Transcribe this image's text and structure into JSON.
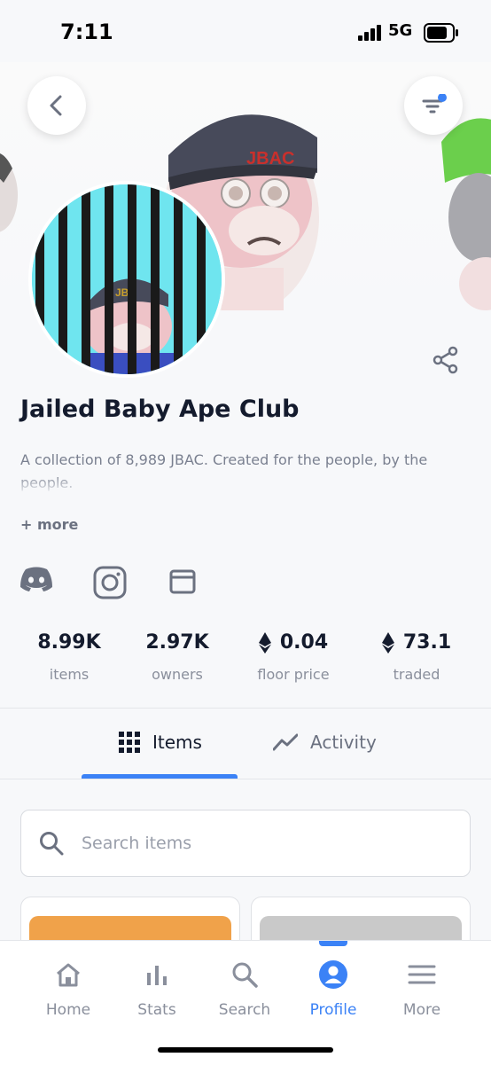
{
  "status_bar": {
    "time": "7:11",
    "network": "5G"
  },
  "collection": {
    "name": "Jailed Baby Ape Club",
    "description": "A collection of 8,989 JBAC. Created for the people, by the people.",
    "more_label": "+ more",
    "avatar_text": "JB",
    "banner_text": "JBAC"
  },
  "social": [
    {
      "name": "discord-icon"
    },
    {
      "name": "instagram-icon"
    },
    {
      "name": "website-icon"
    }
  ],
  "stats": [
    {
      "value": "8.99K",
      "label": "items",
      "eth": false
    },
    {
      "value": "2.97K",
      "label": "owners",
      "eth": false
    },
    {
      "value": "0.04",
      "label": "floor price",
      "eth": true
    },
    {
      "value": "73.1",
      "label": "traded",
      "eth": true
    }
  ],
  "tabs": [
    {
      "label": "Items",
      "active": true
    },
    {
      "label": "Activity",
      "active": false
    }
  ],
  "search": {
    "placeholder": "Search items",
    "value": ""
  },
  "bottom_nav": [
    {
      "label": "Home",
      "icon": "home-icon",
      "active": false
    },
    {
      "label": "Stats",
      "icon": "stats-icon",
      "active": false
    },
    {
      "label": "Search",
      "icon": "search-icon",
      "active": false
    },
    {
      "label": "Profile",
      "icon": "profile-icon",
      "active": true
    },
    {
      "label": "More",
      "icon": "menu-icon",
      "active": false
    }
  ],
  "colors": {
    "accent": "#3b82f6",
    "text": "#141b2d",
    "muted": "#8a8f9c",
    "card_orange": "#f0a24a",
    "card_gray": "#c9c9c9"
  }
}
